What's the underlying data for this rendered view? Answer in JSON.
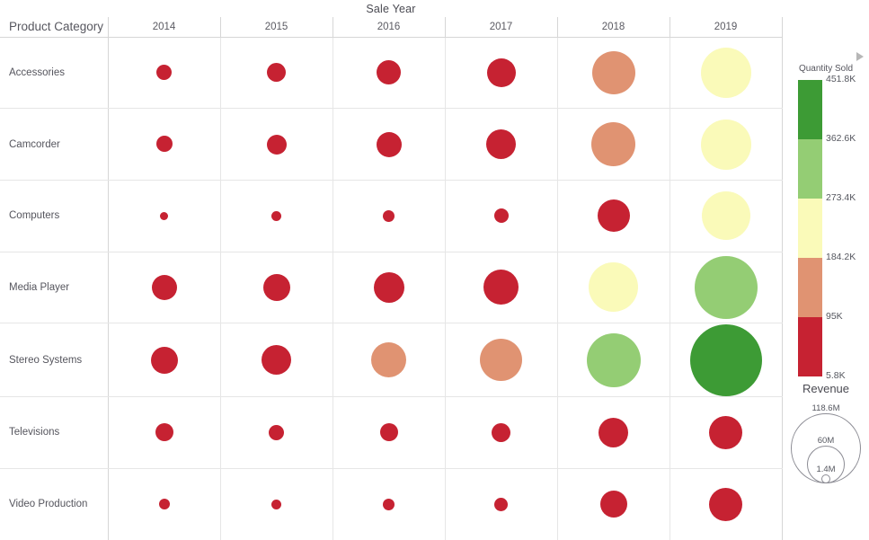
{
  "chart_data": {
    "type": "heatmap",
    "title": "Sale Year",
    "xlabel": "Sale Year",
    "ylabel": "Product Category",
    "row_header": "Product Category",
    "categories": [
      "Accessories",
      "Camcorder",
      "Computers",
      "Media Player",
      "Stereo Systems",
      "Televisions",
      "Video Production"
    ],
    "x": [
      "2014",
      "2015",
      "2016",
      "2017",
      "2018",
      "2019"
    ],
    "size_measure": "Revenue",
    "color_measure": "Quantity Sold",
    "color_scale": {
      "ticks": [
        "451.8K",
        "362.6K",
        "273.4K",
        "184.2K",
        "95K",
        "5.8K"
      ],
      "values": [
        451800,
        362600,
        273400,
        184200,
        95000,
        5800
      ],
      "colors": [
        "#3d9b35",
        "#94cd74",
        "#fafab9",
        "#e09372",
        "#c62232"
      ]
    },
    "size_scale": {
      "ticks": [
        "118.6M",
        "60M",
        "1.4M"
      ],
      "values": [
        118600000,
        60000000,
        1400000
      ],
      "diameters": [
        78,
        42,
        10
      ]
    },
    "cells": [
      {
        "row": "Accessories",
        "col": "2014",
        "size": 17,
        "color": "#c62232",
        "quantity": 34000,
        "revenue": 7500000
      },
      {
        "row": "Accessories",
        "col": "2015",
        "size": 21,
        "color": "#c62232",
        "quantity": 42000,
        "revenue": 11000000
      },
      {
        "row": "Accessories",
        "col": "2016",
        "size": 27,
        "color": "#c62232",
        "quantity": 58000,
        "revenue": 19000000
      },
      {
        "row": "Accessories",
        "col": "2017",
        "size": 32,
        "color": "#c62232",
        "quantity": 82000,
        "revenue": 27000000
      },
      {
        "row": "Accessories",
        "col": "2018",
        "size": 48,
        "color": "#e09372",
        "quantity": 142000,
        "revenue": 55000000
      },
      {
        "row": "Accessories",
        "col": "2019",
        "size": 56,
        "color": "#fafab9",
        "quantity": 228000,
        "revenue": 73000000
      },
      {
        "row": "Camcorder",
        "col": "2014",
        "size": 18,
        "color": "#c62232",
        "quantity": 35000,
        "revenue": 8000000
      },
      {
        "row": "Camcorder",
        "col": "2015",
        "size": 22,
        "color": "#c62232",
        "quantity": 45000,
        "revenue": 12000000
      },
      {
        "row": "Camcorder",
        "col": "2016",
        "size": 28,
        "color": "#c62232",
        "quantity": 62000,
        "revenue": 20000000
      },
      {
        "row": "Camcorder",
        "col": "2017",
        "size": 33,
        "color": "#c62232",
        "quantity": 86000,
        "revenue": 29000000
      },
      {
        "row": "Camcorder",
        "col": "2018",
        "size": 49,
        "color": "#e09372",
        "quantity": 148000,
        "revenue": 57000000
      },
      {
        "row": "Camcorder",
        "col": "2019",
        "size": 56,
        "color": "#fafab9",
        "quantity": 232000,
        "revenue": 74000000
      },
      {
        "row": "Computers",
        "col": "2014",
        "size": 9,
        "color": "#c62232",
        "quantity": 12000,
        "revenue": 2400000
      },
      {
        "row": "Computers",
        "col": "2015",
        "size": 11,
        "color": "#c62232",
        "quantity": 15000,
        "revenue": 3400000
      },
      {
        "row": "Computers",
        "col": "2016",
        "size": 13,
        "color": "#c62232",
        "quantity": 19000,
        "revenue": 4600000
      },
      {
        "row": "Computers",
        "col": "2017",
        "size": 16,
        "color": "#c62232",
        "quantity": 26000,
        "revenue": 6600000
      },
      {
        "row": "Computers",
        "col": "2018",
        "size": 36,
        "color": "#c62232",
        "quantity": 88000,
        "revenue": 33000000
      },
      {
        "row": "Computers",
        "col": "2019",
        "size": 54,
        "color": "#fafab9",
        "quantity": 222000,
        "revenue": 69000000
      },
      {
        "row": "Media Player",
        "col": "2014",
        "size": 28,
        "color": "#c62232",
        "quantity": 64000,
        "revenue": 21000000
      },
      {
        "row": "Media Player",
        "col": "2015",
        "size": 30,
        "color": "#c62232",
        "quantity": 72000,
        "revenue": 24000000
      },
      {
        "row": "Media Player",
        "col": "2016",
        "size": 34,
        "color": "#c62232",
        "quantity": 90000,
        "revenue": 31000000
      },
      {
        "row": "Media Player",
        "col": "2017",
        "size": 39,
        "color": "#c62232",
        "quantity": 94000,
        "revenue": 40000000
      },
      {
        "row": "Media Player",
        "col": "2018",
        "size": 55,
        "color": "#fafab9",
        "quantity": 215000,
        "revenue": 71000000
      },
      {
        "row": "Media Player",
        "col": "2019",
        "size": 70,
        "color": "#94cd74",
        "quantity": 318000,
        "revenue": 99000000
      },
      {
        "row": "Stereo Systems",
        "col": "2014",
        "size": 30,
        "color": "#c62232",
        "quantity": 70000,
        "revenue": 24000000
      },
      {
        "row": "Stereo Systems",
        "col": "2015",
        "size": 33,
        "color": "#c62232",
        "quantity": 86000,
        "revenue": 29000000
      },
      {
        "row": "Stereo Systems",
        "col": "2016",
        "size": 39,
        "color": "#e09372",
        "quantity": 120000,
        "revenue": 40000000
      },
      {
        "row": "Stereo Systems",
        "col": "2017",
        "size": 47,
        "color": "#e09372",
        "quantity": 160000,
        "revenue": 53000000
      },
      {
        "row": "Stereo Systems",
        "col": "2018",
        "size": 60,
        "color": "#94cd74",
        "quantity": 290000,
        "revenue": 80000000
      },
      {
        "row": "Stereo Systems",
        "col": "2019",
        "size": 80,
        "color": "#3d9b35",
        "quantity": 430000,
        "revenue": 118600000
      },
      {
        "row": "Televisions",
        "col": "2014",
        "size": 20,
        "color": "#c62232",
        "quantity": 38000,
        "revenue": 10000000
      },
      {
        "row": "Televisions",
        "col": "2015",
        "size": 17,
        "color": "#c62232",
        "quantity": 32000,
        "revenue": 7200000
      },
      {
        "row": "Televisions",
        "col": "2016",
        "size": 20,
        "color": "#c62232",
        "quantity": 39000,
        "revenue": 10000000
      },
      {
        "row": "Televisions",
        "col": "2017",
        "size": 21,
        "color": "#c62232",
        "quantity": 43000,
        "revenue": 11000000
      },
      {
        "row": "Televisions",
        "col": "2018",
        "size": 33,
        "color": "#c62232",
        "quantity": 80000,
        "revenue": 28000000
      },
      {
        "row": "Televisions",
        "col": "2019",
        "size": 37,
        "color": "#c62232",
        "quantity": 92000,
        "revenue": 36000000
      },
      {
        "row": "Video Production",
        "col": "2014",
        "size": 12,
        "color": "#c62232",
        "quantity": 17000,
        "revenue": 3900000
      },
      {
        "row": "Video Production",
        "col": "2015",
        "size": 11,
        "color": "#c62232",
        "quantity": 15000,
        "revenue": 3400000
      },
      {
        "row": "Video Production",
        "col": "2016",
        "size": 13,
        "color": "#c62232",
        "quantity": 19000,
        "revenue": 4600000
      },
      {
        "row": "Video Production",
        "col": "2017",
        "size": 15,
        "color": "#c62232",
        "quantity": 23000,
        "revenue": 5800000
      },
      {
        "row": "Video Production",
        "col": "2018",
        "size": 30,
        "color": "#c62232",
        "quantity": 68000,
        "revenue": 23000000
      },
      {
        "row": "Video Production",
        "col": "2019",
        "size": 37,
        "color": "#c62232",
        "quantity": 92000,
        "revenue": 36000000
      }
    ]
  },
  "legend": {
    "color_title": "Quantity Sold",
    "size_title": "Revenue",
    "collapse_icon": "collapse-arrow-icon"
  }
}
